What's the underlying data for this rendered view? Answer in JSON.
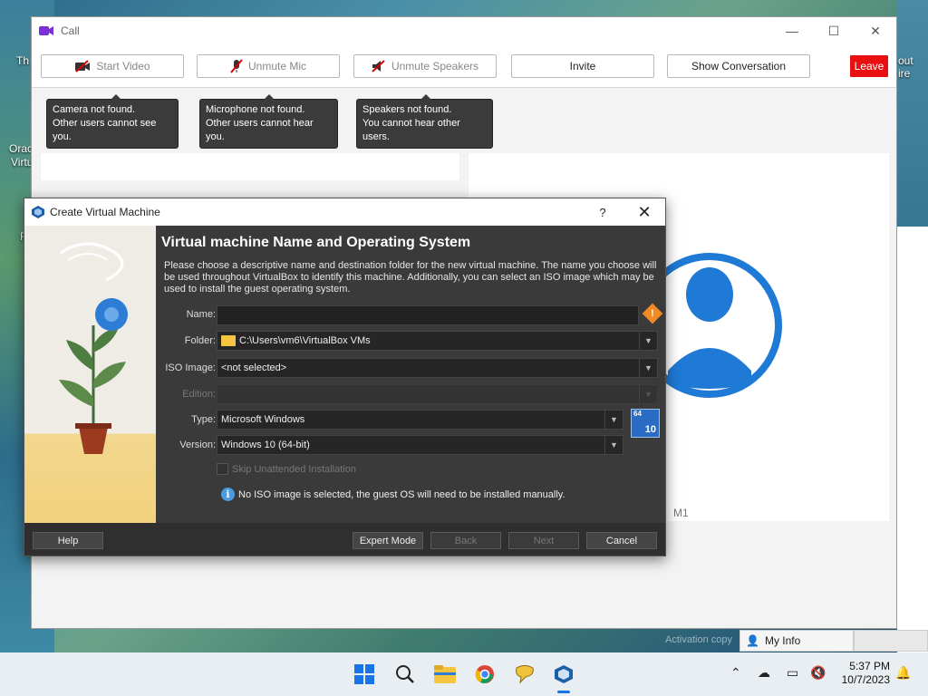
{
  "desktop": {
    "icon_labels": [
      "Th",
      "Orac",
      "Virtu",
      "out",
      "ire",
      "F"
    ]
  },
  "call_window": {
    "title": "Call",
    "controls": {
      "minimize": "—",
      "maximize": "☐",
      "close": "✕"
    },
    "toolbar": {
      "start_video": "Start Video",
      "unmute_mic": "Unmute Mic",
      "unmute_speakers": "Unmute Speakers",
      "invite": "Invite",
      "show_conversation": "Show Conversation",
      "leave": "Leave"
    },
    "tooltips": {
      "camera_line1": "Camera not found.",
      "camera_line2": "Other users cannot see you.",
      "mic_line1": "Microphone not found.",
      "mic_line2": "Other users cannot hear you.",
      "speakers_line1": "Speakers not found.",
      "speakers_line2": "You cannot hear other users."
    },
    "participant_label": "M1",
    "colors": {
      "leave": "#e81010",
      "muted_icon": "#c20000",
      "avatar": "#1f7ad6"
    }
  },
  "dialog": {
    "title": "Create Virtual Machine",
    "help_glyph": "?",
    "close_glyph": "✕",
    "heading": "Virtual machine Name and Operating System",
    "description": "Please choose a descriptive name and destination folder for the new virtual machine. The name you choose will be used throughout VirtualBox to identify this machine. Additionally, you can select an ISO image which may be used to install the guest operating system.",
    "labels": {
      "name": "Name:",
      "folder": "Folder:",
      "iso": "ISO Image:",
      "edition": "Edition:",
      "type": "Type:",
      "version": "Version:"
    },
    "values": {
      "name": "",
      "folder": "C:\\Users\\vm6\\VirtualBox VMs",
      "iso": "<not selected>",
      "edition": "",
      "type": "Microsoft Windows",
      "version": "Windows 10 (64-bit)"
    },
    "os_badge": {
      "bits": "64",
      "version": "10"
    },
    "skip_unattended": "Skip Unattended Installation",
    "info_message": "No ISO image is selected, the guest OS will need to be installed manually.",
    "buttons": {
      "help": "Help",
      "expert_mode": "Expert Mode",
      "back": "Back",
      "next": "Next",
      "cancel": "Cancel"
    }
  },
  "status": {
    "my_info": "My Info",
    "watermark": "Activation copy"
  },
  "taskbar": {
    "icons": [
      "windows-start",
      "search",
      "file-explorer",
      "chrome",
      "chat",
      "virtualbox"
    ],
    "time": "5:37 PM",
    "date": "10/7/2023"
  }
}
